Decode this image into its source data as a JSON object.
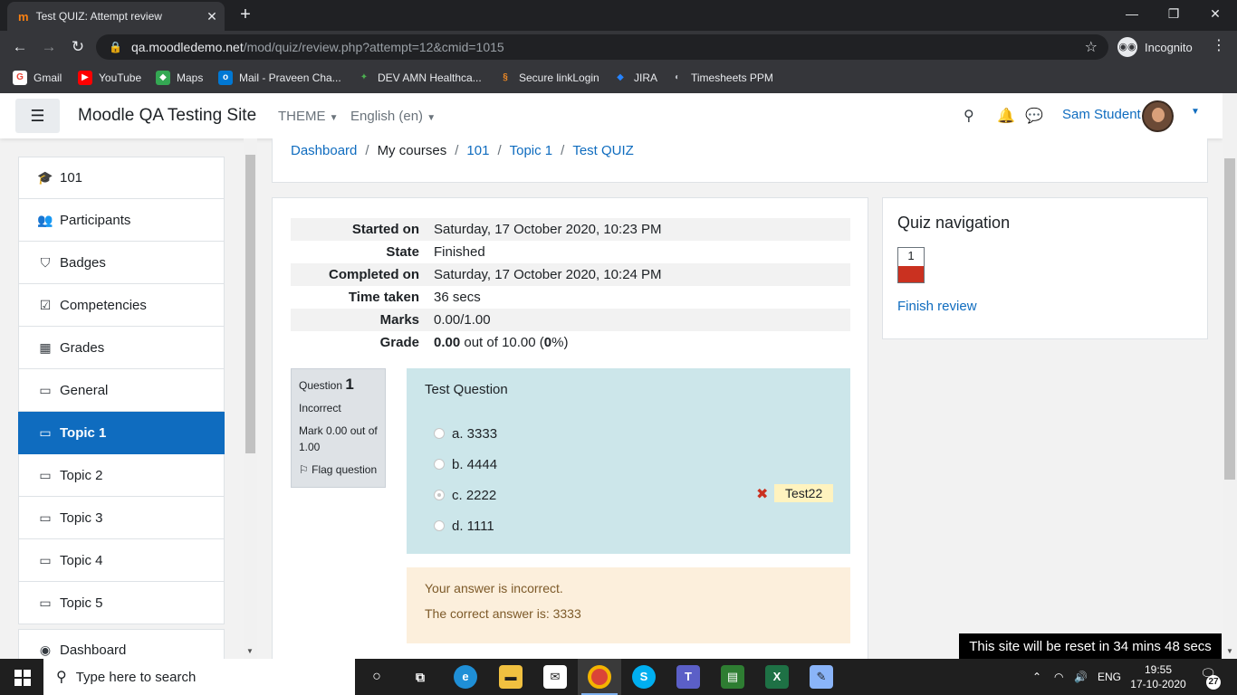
{
  "browser": {
    "tab_title": "Test QUIZ: Attempt review",
    "tab_favicon": "m",
    "url_host": "qa.moodledemo.net",
    "url_path": "/mod/quiz/review.php?attempt=12&cmid=1015",
    "incognito_label": "Incognito",
    "bookmarks": [
      {
        "label": "Gmail",
        "icon": "G",
        "color": "#ffffff",
        "fg": "#ea4335"
      },
      {
        "label": "YouTube",
        "icon": "▶",
        "color": "#ff0000",
        "fg": "#ffffff"
      },
      {
        "label": "Maps",
        "icon": "◆",
        "color": "#34a853",
        "fg": "#ffffff"
      },
      {
        "label": "Mail - Praveen Cha...",
        "icon": "o",
        "color": "#0078d4",
        "fg": "#ffffff"
      },
      {
        "label": "DEV AMN Healthca...",
        "icon": "✦",
        "color": "#35363a",
        "fg": "#4caf50"
      },
      {
        "label": "Secure linkLogin",
        "icon": "§",
        "color": "#35363a",
        "fg": "#f28b25"
      },
      {
        "label": "JIRA",
        "icon": "◆",
        "color": "#35363a",
        "fg": "#2684ff"
      },
      {
        "label": "Timesheets PPM",
        "icon": "◐",
        "color": "#35363a",
        "fg": "#bdc1c6"
      }
    ]
  },
  "header": {
    "site_name": "Moodle QA Testing Site",
    "theme_label": "THEME",
    "language_label": "English (en)",
    "user_name": "Sam Student"
  },
  "drawer": {
    "items": [
      {
        "label": "101",
        "icon": "🎓"
      },
      {
        "label": "Participants",
        "icon": "👥"
      },
      {
        "label": "Badges",
        "icon": "⛉"
      },
      {
        "label": "Competencies",
        "icon": "☑"
      },
      {
        "label": "Grades",
        "icon": "▦"
      },
      {
        "label": "General",
        "icon": "▭"
      },
      {
        "label": "Topic 1",
        "icon": "▭"
      },
      {
        "label": "Topic 2",
        "icon": "▭"
      },
      {
        "label": "Topic 3",
        "icon": "▭"
      },
      {
        "label": "Topic 4",
        "icon": "▭"
      },
      {
        "label": "Topic 5",
        "icon": "▭"
      },
      {
        "label": "Dashboard",
        "icon": "◉"
      }
    ]
  },
  "breadcrumb": [
    "Dashboard",
    "My courses",
    "101",
    "Topic 1",
    "Test QUIZ"
  ],
  "summary": {
    "started_on_label": "Started on",
    "started_on": "Saturday, 17 October 2020, 10:23 PM",
    "state_label": "State",
    "state": "Finished",
    "completed_on_label": "Completed on",
    "completed_on": "Saturday, 17 October 2020, 10:24 PM",
    "time_taken_label": "Time taken",
    "time_taken": "36 secs",
    "marks_label": "Marks",
    "marks": "0.00/1.00",
    "grade_label": "Grade",
    "grade_value": "0.00",
    "grade_mid": "out of 10.00 (",
    "grade_percent": "0",
    "grade_end": "%)"
  },
  "question": {
    "label": "Question",
    "number": "1",
    "status": "Incorrect",
    "mark": "Mark 0.00 out of 1.00",
    "flag": "Flag question",
    "text": "Test Question",
    "options": [
      {
        "label": "a. 3333"
      },
      {
        "label": "b. 4444"
      },
      {
        "label": "c. 2222"
      },
      {
        "label": "d. 1111"
      }
    ],
    "selected_feedback": "Test22",
    "outcome_incorrect": "Your answer is incorrect.",
    "outcome_correct": "The correct answer is: 3333"
  },
  "quiz_nav": {
    "title": "Quiz navigation",
    "question_button": "1",
    "finish_review": "Finish review"
  },
  "reset_notice": "This site will be reset in 34 mins 48 secs",
  "taskbar": {
    "search_placeholder": "Type here to search",
    "lang": "ENG",
    "time": "19:55",
    "date": "17-10-2020",
    "notification_count": "27"
  }
}
